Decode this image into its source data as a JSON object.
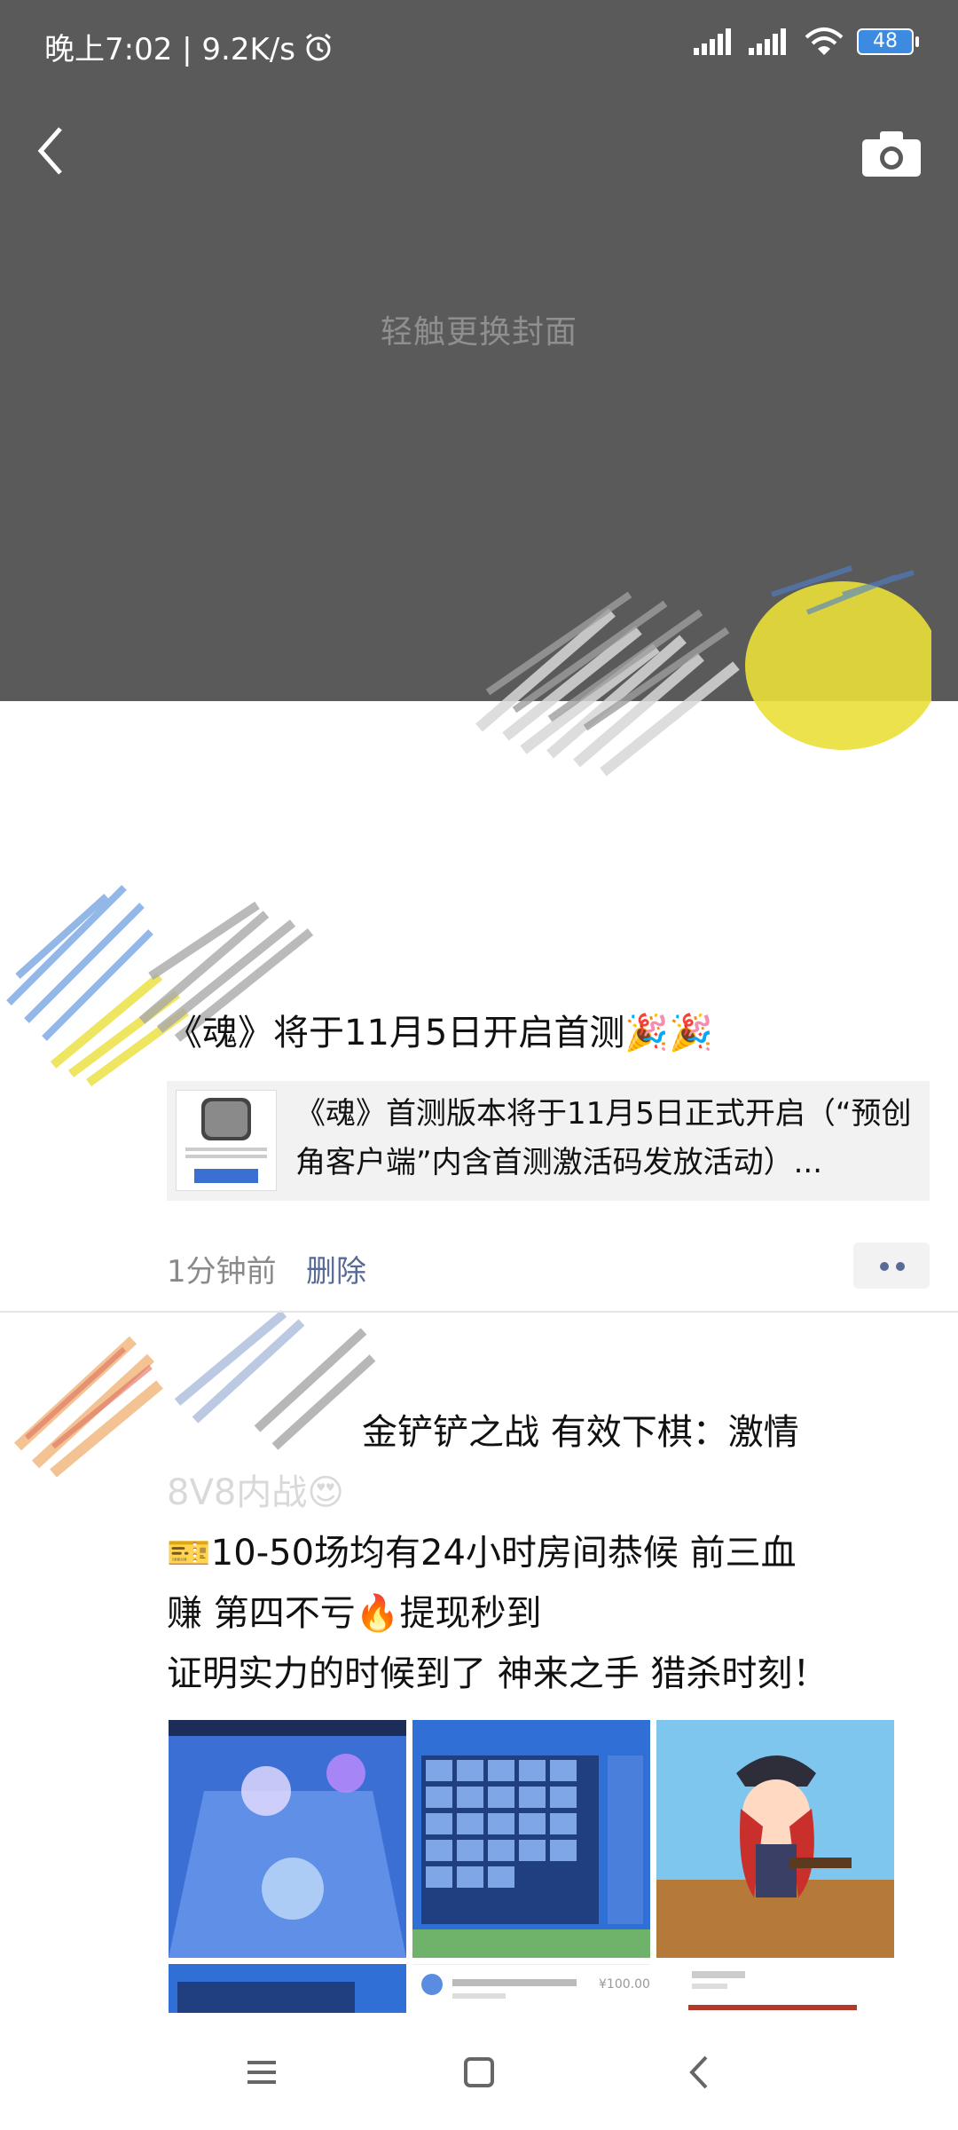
{
  "status_bar": {
    "time_speed": "晚上7:02 | 9.2K/s",
    "battery": "48"
  },
  "cover": {
    "hint": "轻触更换封面"
  },
  "post1": {
    "text": "《魂》将于11月5日开启首测🎉🎉",
    "link_title": "《魂》首测版本将于11月5日正式开启（“预创角客户端”内含首测激活码发放活动）...",
    "time": "1分钟前",
    "delete": "删除"
  },
  "post2": {
    "line1": "金铲铲之战 有效下棋：激情",
    "line2": "8V8内战😍",
    "line3": "🎫10-50场均有24小时房间恭候 前三血",
    "line4": "赚 第四不亏🔥提现秒到",
    "line5": "证明实力的时候到了 神来之手 猎杀时刻！",
    "card_amount": "¥100.00"
  }
}
